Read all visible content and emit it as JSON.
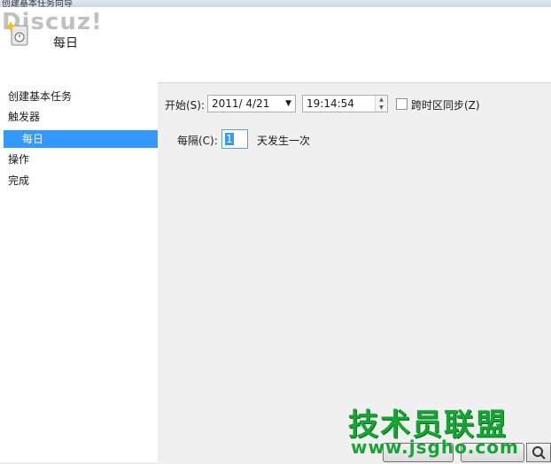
{
  "window": {
    "title": "创建基本任务向导"
  },
  "header": {
    "title": "每日",
    "watermark": "Discuz!"
  },
  "nav": {
    "items": [
      "创建基本任务",
      "触发器",
      "每日",
      "操作",
      "完成"
    ]
  },
  "form": {
    "start_label": "开始(S):",
    "start_date": "2011/ 4/21",
    "start_time": "19:14:54",
    "sync_label": "跨时区同步(Z)",
    "recur_label": "每隔(C):",
    "recur_value": "1",
    "recur_suffix": "天发生一次"
  },
  "watermark": {
    "logo": "技术员联盟",
    "url": "www.jsgho.com"
  },
  "colors": {
    "selection": "#3399ff",
    "watermark_green": "#16a534"
  }
}
